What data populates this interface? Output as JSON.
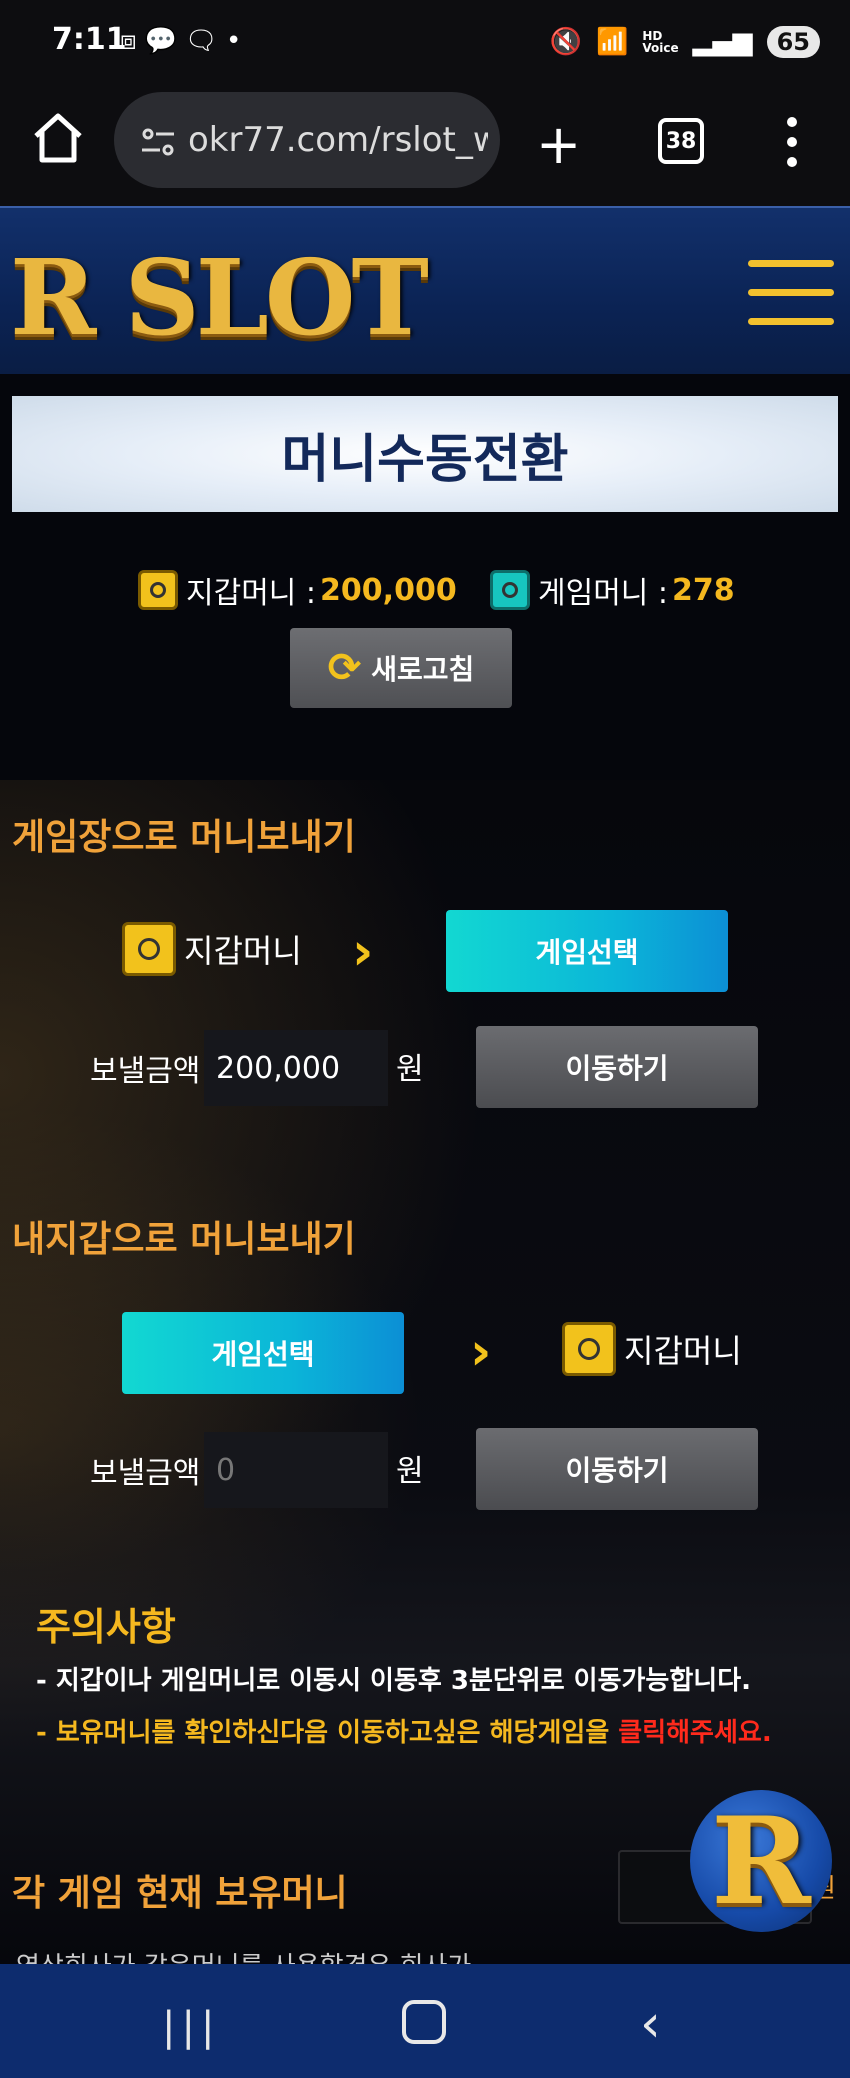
{
  "status_bar": {
    "time": "7:11",
    "battery": "65",
    "hd_label": "HD",
    "voice_label": "Voice"
  },
  "browser": {
    "url": "okr77.com/rslot_w",
    "tab_count": "38"
  },
  "site": {
    "logo_text": "R SLOT",
    "page_title": "머니수동전환"
  },
  "balances": {
    "wallet_label": "지갑머니 : ",
    "wallet_value": "200,000",
    "game_label": "게임머니 : ",
    "game_value": "278",
    "refresh_label": "새로고침"
  },
  "to_game": {
    "title": "게임장으로 머니보내기",
    "from_label": "지갑머니",
    "select_label": "게임선택",
    "amount_label": "보낼금액",
    "amount_value": "200,000",
    "unit": "원",
    "move_label": "이동하기"
  },
  "to_wallet": {
    "title": "내지갑으로 머니보내기",
    "select_label": "게임선택",
    "to_label": "지갑머니",
    "amount_label": "보낼금액",
    "amount_placeholder": "0",
    "unit": "원",
    "move_label": "이동하기"
  },
  "notice": {
    "title": "주의사항",
    "line1": "- 지갑이나 게임머니로 이동시 이동후 3분단위로 이동가능합니다.",
    "line2_prefix": "- 보유머니를 확인하신다음 이동하고싶은 해당게임을 ",
    "line2_highlight": "클릭해주세요."
  },
  "game_money": {
    "title": "각 게임 현재 보유머니",
    "unit": "원",
    "cut_text": "영상회사가 같은머니를 사용할경우 회사가"
  },
  "badge": {
    "letter": "R"
  },
  "colors": {
    "accent_gold": "#f5b81f",
    "section_orange": "#f0a23a",
    "header_blue": "#0b2354",
    "cyan": "#12d8d2",
    "warning_red": "#ff2a1c"
  },
  "icons": {
    "wallet": "safe-icon",
    "refresh": "refresh-icon",
    "arrow": "chevron-right-icon"
  }
}
